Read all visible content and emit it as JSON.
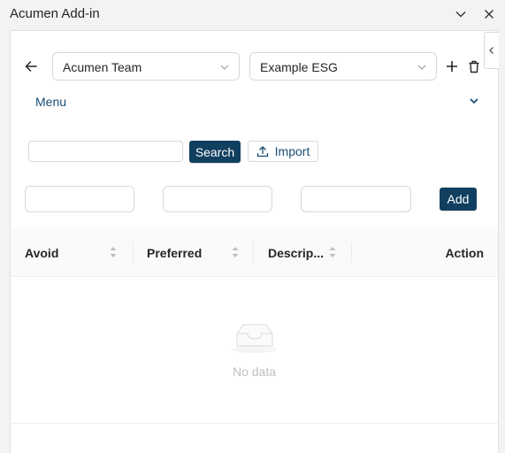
{
  "window": {
    "title": "Acumen Add-in"
  },
  "toolbar": {
    "team_select": {
      "value": "Acumen Team"
    },
    "list_select": {
      "value": "Example ESG"
    },
    "icons": [
      "back-arrow-icon",
      "chevron-down-icon",
      "plus-icon",
      "trash-icon"
    ]
  },
  "menu": {
    "label": "Menu"
  },
  "search": {
    "input_value": "",
    "search_label": "Search",
    "import_label": "Import"
  },
  "add_form": {
    "field1_value": "",
    "field2_value": "",
    "field3_value": "",
    "add_label": "Add"
  },
  "table": {
    "columns": [
      "Avoid",
      "Preferred",
      "Descrip...",
      "Action"
    ],
    "rows": [],
    "empty_text": "No data"
  },
  "colors": {
    "primary": "#103f5f",
    "link": "#1a4d72",
    "border": "#d9d9d9",
    "muted_text": "#bfbfbf"
  }
}
